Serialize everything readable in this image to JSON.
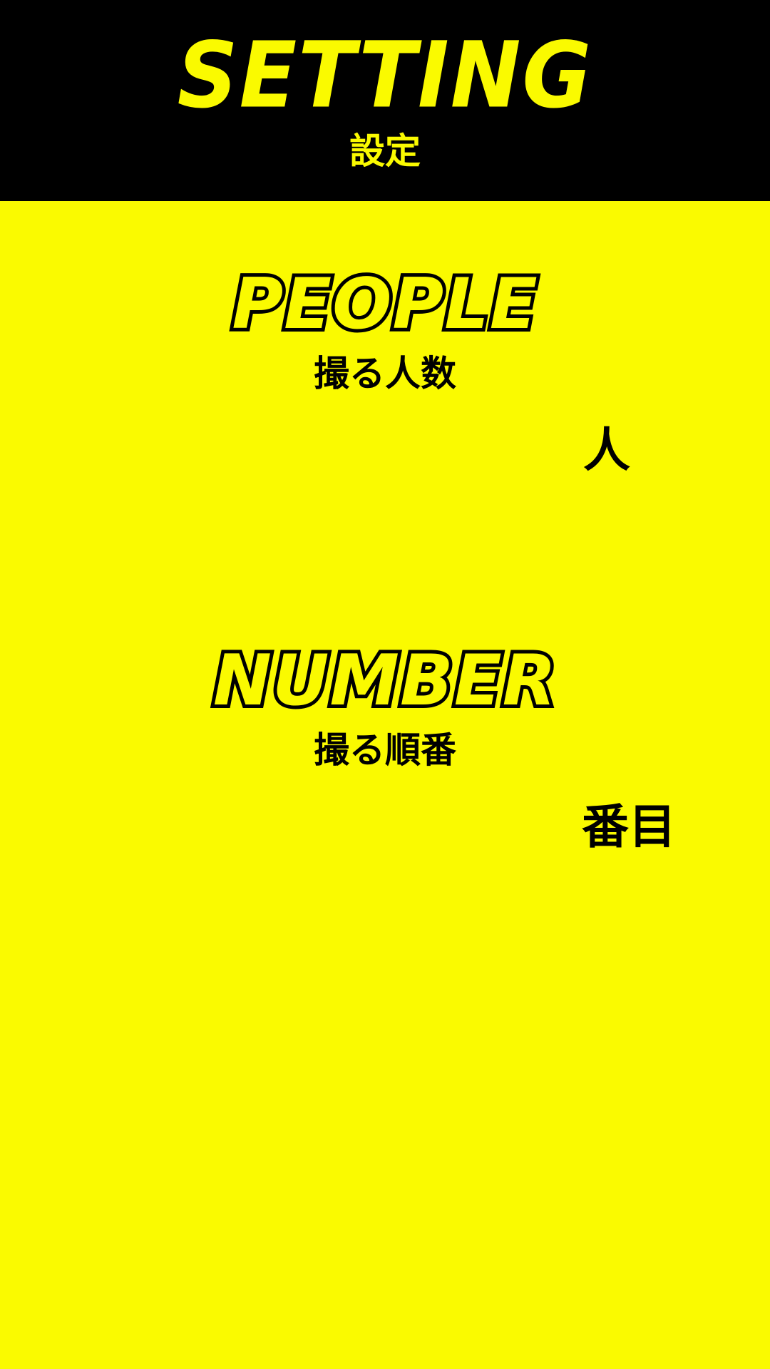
{
  "header": {
    "title": "SETTING",
    "subtitle": "設定"
  },
  "people": {
    "title": "PEOPLE",
    "subtitle": "撮る人数",
    "unit": "人"
  },
  "number": {
    "title": "NUMBER",
    "subtitle": "撮る順番",
    "unit": "番目"
  },
  "colors": {
    "background": "#FAFA00",
    "header_background": "#000000",
    "accent": "#FAFA00",
    "text": "#000000"
  }
}
